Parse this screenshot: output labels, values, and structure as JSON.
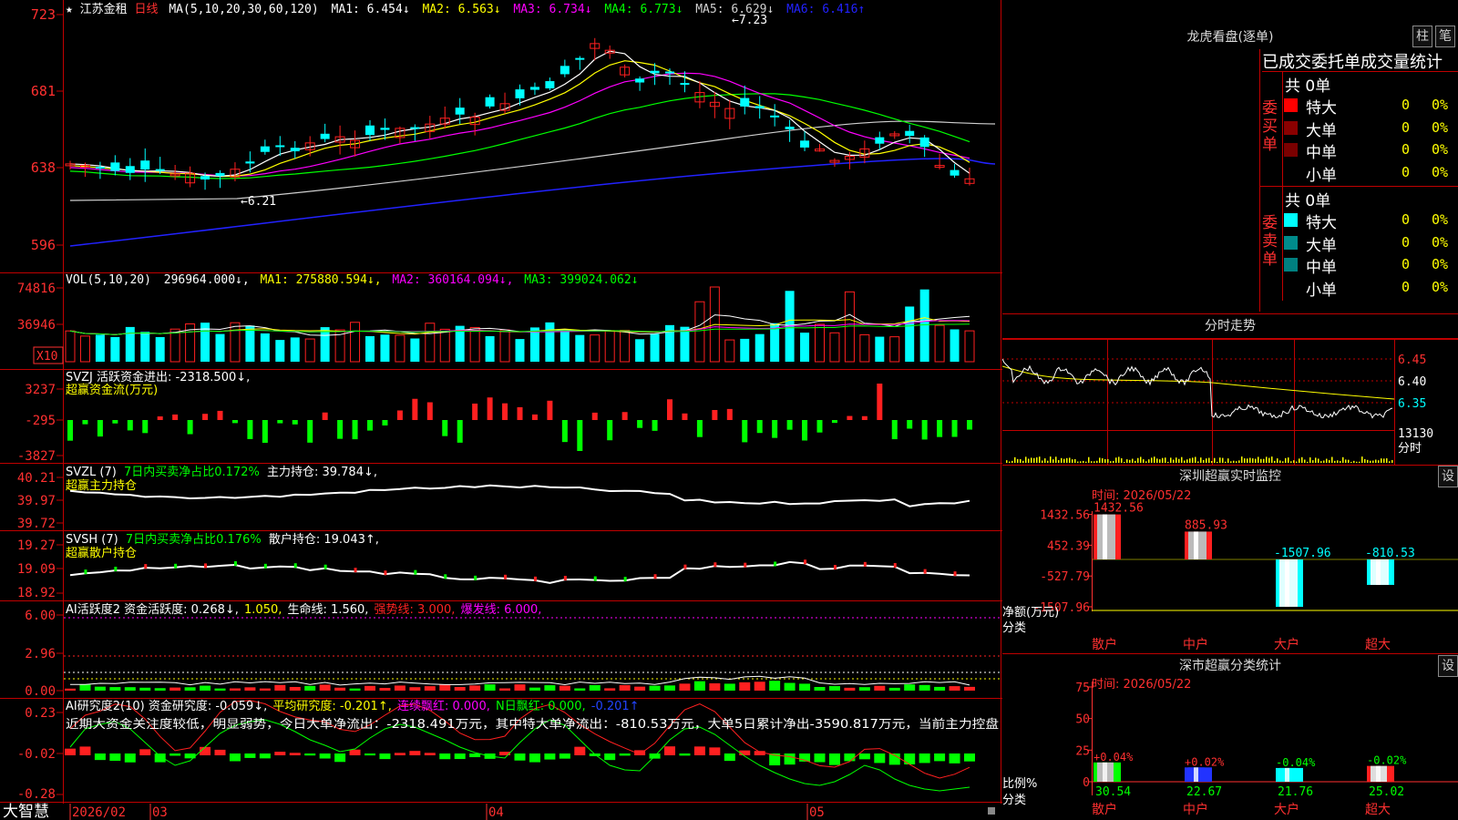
{
  "app_name": "大智慧",
  "main_header": {
    "star": "★",
    "stock": "江苏金租",
    "period": "日线",
    "ma_def": "MA(5,10,20,30,60,120)",
    "items": [
      {
        "text": "MA1: 6.454↓",
        "color": "#ffffff"
      },
      {
        "text": "MA2: 6.563↓",
        "color": "#ffff00"
      },
      {
        "text": "MA3: 6.734↓",
        "color": "#ff00ff"
      },
      {
        "text": "MA4: 6.773↓",
        "color": "#00ff00"
      },
      {
        "text": "MA5: 6.629↓",
        "color": "#d0d0d0"
      },
      {
        "text": "MA6: 6.416↑",
        "color": "#2222ff"
      }
    ]
  },
  "price_axis": [
    "723",
    "681",
    "638",
    "596"
  ],
  "price_marks": {
    "high": "7.23",
    "low": "6.21"
  },
  "vol_header": {
    "def": "VOL(5,10,20)",
    "items": [
      {
        "text": "296964.000↓,",
        "color": "#ffffff"
      },
      {
        "text": "MA1: 275880.594↓,",
        "color": "#ffff00"
      },
      {
        "text": "MA2: 360164.094↓,",
        "color": "#ff00ff"
      },
      {
        "text": "MA3: 399024.062↓",
        "color": "#00ff00"
      }
    ]
  },
  "vol_axis": [
    "74816",
    "36946"
  ],
  "vol_unit": "X10",
  "svzj": {
    "line1": "SVZJ  活跃资金进出: -2318.500↓,",
    "line2": "超赢资金流(万元)",
    "axis": [
      "3237",
      "-295",
      "-3827"
    ]
  },
  "svzl": {
    "name": "SVZL (7)",
    "label1": "7日内买卖净占比0.172%",
    "label2": "主力持仓: 39.784↓,",
    "line2": "超赢主力持仓",
    "axis": [
      "40.21",
      "39.97",
      "39.72"
    ]
  },
  "svsh": {
    "name": "SVSH (7)",
    "label1": "7日内买卖净占比0.176%",
    "label2": "散户持仓: 19.043↑,",
    "line2": "超赢散户持仓",
    "axis": [
      "19.27",
      "19.09",
      "18.92"
    ]
  },
  "ai_active": {
    "items": [
      {
        "text": "AI活跃度2 资金活跃度: 0.268↓,",
        "color": "#ffffff"
      },
      {
        "text": "1.050,",
        "color": "#ffff00"
      },
      {
        "text": "生命线: 1.560,",
        "color": "#ffffff"
      },
      {
        "text": "强势线: 3.000,",
        "color": "#ff2222"
      },
      {
        "text": "爆发线: 6.000,",
        "color": "#ff00ff"
      }
    ],
    "axis": [
      "6.00",
      "2.96",
      "0.00"
    ]
  },
  "ai_research": {
    "items": [
      {
        "text": "AI研究度2(10) 资金研究度: -0.059↓,",
        "color": "#ffffff"
      },
      {
        "text": "平均研究度: -0.201↑,",
        "color": "#ffff00"
      },
      {
        "text": "连续飘红: 0.000,",
        "color": "#ff00ff"
      },
      {
        "text": "N日飘红: 0.000,",
        "color": "#00ff00"
      },
      {
        "text": "-0.201↑",
        "color": "#2244ff"
      }
    ],
    "comment": "近期大资金关注度较低，明显弱势，今日大单净流出：-2318.491万元，其中特大单净流出：-810.53万元，大单5日累计净出-3590.817万元，当前主力控盘",
    "axis": [
      "0.23",
      "-0.02",
      "-0.28"
    ]
  },
  "date_axis": [
    {
      "text": "2026/02"
    },
    {
      "text": "03"
    },
    {
      "text": "04"
    },
    {
      "text": "05"
    }
  ],
  "lhb": {
    "title": "龙虎看盘(逐单)",
    "btn1": "柱",
    "btn2": "笔",
    "table_title": "已成交委托单成交量统计",
    "buy": {
      "side": "委买单",
      "total": "共 0单",
      "rows": [
        {
          "label": "特大",
          "n": "0",
          "pct": "0%",
          "color": "#ff0000"
        },
        {
          "label": "大单",
          "n": "0",
          "pct": "0%",
          "color": "#8b0000"
        },
        {
          "label": "中单",
          "n": "0",
          "pct": "0%",
          "color": "#7a0000"
        },
        {
          "label": "小单",
          "n": "0",
          "pct": "0%",
          "color": ""
        }
      ]
    },
    "sell": {
      "side": "委卖单",
      "total": "共 0单",
      "rows": [
        {
          "label": "特大",
          "n": "0",
          "pct": "0%",
          "color": "#00ffff"
        },
        {
          "label": "大单",
          "n": "0",
          "pct": "0%",
          "color": "#008b8b"
        },
        {
          "label": "中单",
          "n": "0",
          "pct": "0%",
          "color": "#008080"
        },
        {
          "label": "小单",
          "n": "0",
          "pct": "0%",
          "color": ""
        }
      ]
    }
  },
  "intraday": {
    "title": "分时走势",
    "axis": [
      "6.45",
      "6.40",
      "6.35"
    ],
    "vol_label": "13130",
    "time_label": "分时"
  },
  "monitor": {
    "title": "深圳超赢实时监控",
    "setting": "设",
    "time": "时间: 2026/05/22",
    "axis": [
      "1432.56",
      "452.39",
      "-527.79",
      "-1507.96"
    ],
    "unit": "净额(万元)",
    "class_label": "分类",
    "bars": [
      {
        "name": "散户",
        "value": 1432.56,
        "label": "1432.56"
      },
      {
        "name": "中户",
        "value": 885.93,
        "label": "885.93"
      },
      {
        "name": "大户",
        "value": -1507.96,
        "label": "-1507.96"
      },
      {
        "name": "超大",
        "value": -810.53,
        "label": "-810.53"
      }
    ]
  },
  "classify": {
    "title": "深市超赢分类统计",
    "setting": "设",
    "time": "时间: 2026/05/22",
    "axis": [
      "75",
      "50",
      "25",
      "0"
    ],
    "ratio_label": "比例%",
    "class_label": "分类",
    "bars": [
      {
        "name": "散户",
        "value": 30.54,
        "label": "30.54",
        "change": "+0.04%",
        "color": "#00ff00"
      },
      {
        "name": "中户",
        "value": 22.67,
        "label": "22.67",
        "change": "+0.02%",
        "color": "#2233ff"
      },
      {
        "name": "大户",
        "value": 21.76,
        "label": "21.76",
        "change": "-0.04%",
        "color": "#00ffff"
      },
      {
        "name": "超大",
        "value": 25.02,
        "label": "25.02",
        "change": "-0.02%",
        "color": "#ff2020"
      }
    ]
  }
}
